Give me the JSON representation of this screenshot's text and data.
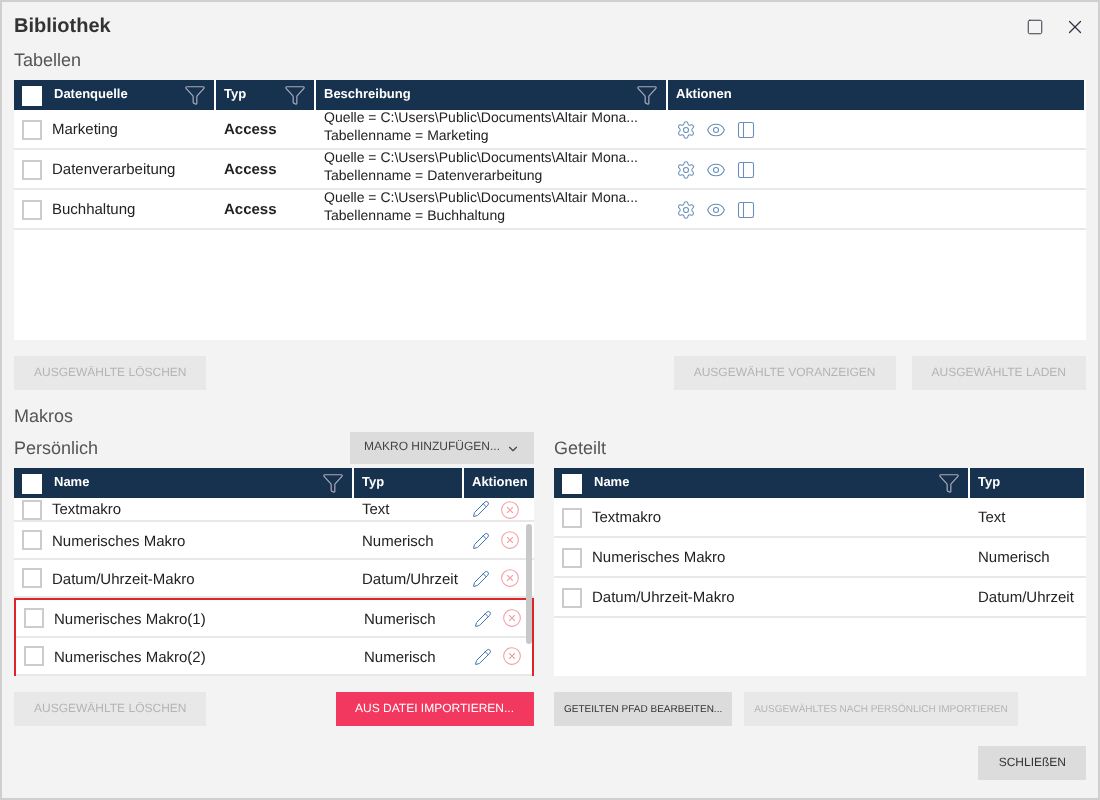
{
  "window": {
    "title": "Bibliothek"
  },
  "tables_section": {
    "label": "Tabellen",
    "all_checked": false,
    "columns": [
      {
        "label": "Datenquelle",
        "filter": true
      },
      {
        "label": "Typ",
        "filter": true
      },
      {
        "label": "Beschreibung",
        "filter": true
      },
      {
        "label": "Aktionen",
        "filter": false
      }
    ],
    "rows": [
      {
        "checked": false,
        "name": "Marketing",
        "type": "Access",
        "description": [
          "Quelle = C:\\Users\\Public\\Documents\\Altair Mona...",
          "Tabellenname = Marketing"
        ]
      },
      {
        "checked": false,
        "name": "Datenverarbeitung",
        "type": "Access",
        "description": [
          "Quelle = C:\\Users\\Public\\Documents\\Altair Mona...",
          "Tabellenname = Datenverarbeitung"
        ]
      },
      {
        "checked": false,
        "name": "Buchhaltung",
        "type": "Access",
        "description": [
          "Quelle = C:\\Users\\Public\\Documents\\Altair Mona...",
          "Tabellenname = Buchhaltung"
        ]
      }
    ],
    "buttons_left": [
      {
        "label": "AUSGEWÄHLTE LÖSCHEN",
        "kind": "plain",
        "disabled": true
      }
    ],
    "buttons_right": [
      {
        "label": "AUSGEWÄHLTE VORANZEIGEN",
        "kind": "plain",
        "disabled": true
      },
      {
        "label": "AUSGEWÄHLTE LADEN",
        "kind": "plain",
        "disabled": true
      }
    ]
  },
  "macros_section": {
    "label": "Makros",
    "personal": {
      "label": "Persönlich",
      "all_checked": false,
      "add_button": "MAKRO HINZUFÜGEN...",
      "columns": [
        {
          "label": "Name",
          "filter": true
        },
        {
          "label": "Typ",
          "filter": false
        },
        {
          "label": "Aktionen",
          "filter": false
        }
      ],
      "rows": [
        {
          "checked": false,
          "highlighted": false,
          "name": "Textmakro",
          "type": "Text"
        },
        {
          "checked": false,
          "highlighted": false,
          "name": "Numerisches Makro",
          "type": "Numerisch"
        },
        {
          "checked": false,
          "highlighted": false,
          "name": "Datum/Uhrzeit-Makro",
          "type": "Datum/Uhrzeit"
        },
        {
          "checked": false,
          "highlighted": true,
          "name": "Numerisches Makro(1)",
          "type": "Numerisch"
        },
        {
          "checked": false,
          "highlighted": true,
          "name": "Numerisches Makro(2)",
          "type": "Numerisch"
        }
      ],
      "buttons": [
        {
          "label": "AUSGEWÄHLTE LÖSCHEN",
          "kind": "plain",
          "disabled": true
        },
        {
          "label": "AUS DATEI IMPORTIEREN...",
          "kind": "primary",
          "disabled": false
        }
      ]
    },
    "shared": {
      "label": "Geteilt",
      "all_checked": false,
      "columns": [
        {
          "label": "Name",
          "filter": true
        },
        {
          "label": "Typ",
          "filter": false
        }
      ],
      "rows": [
        {
          "checked": false,
          "name": "Textmakro",
          "type": "Text"
        },
        {
          "checked": false,
          "name": "Numerisches Makro",
          "type": "Numerisch"
        },
        {
          "checked": false,
          "name": "Datum/Uhrzeit-Makro",
          "type": "Datum/Uhrzeit"
        }
      ],
      "buttons": [
        {
          "label": "GETEILTEN PFAD BEARBEITEN...",
          "kind": "plain",
          "disabled": false
        },
        {
          "label": "AUSGEWÄHLTES NACH PERSÖNLICH IMPORTIEREN",
          "kind": "plain",
          "disabled": true
        }
      ]
    }
  },
  "footer": {
    "buttons": [
      {
        "label": "SCHLIEßEN",
        "kind": "plain",
        "disabled": false
      }
    ]
  }
}
